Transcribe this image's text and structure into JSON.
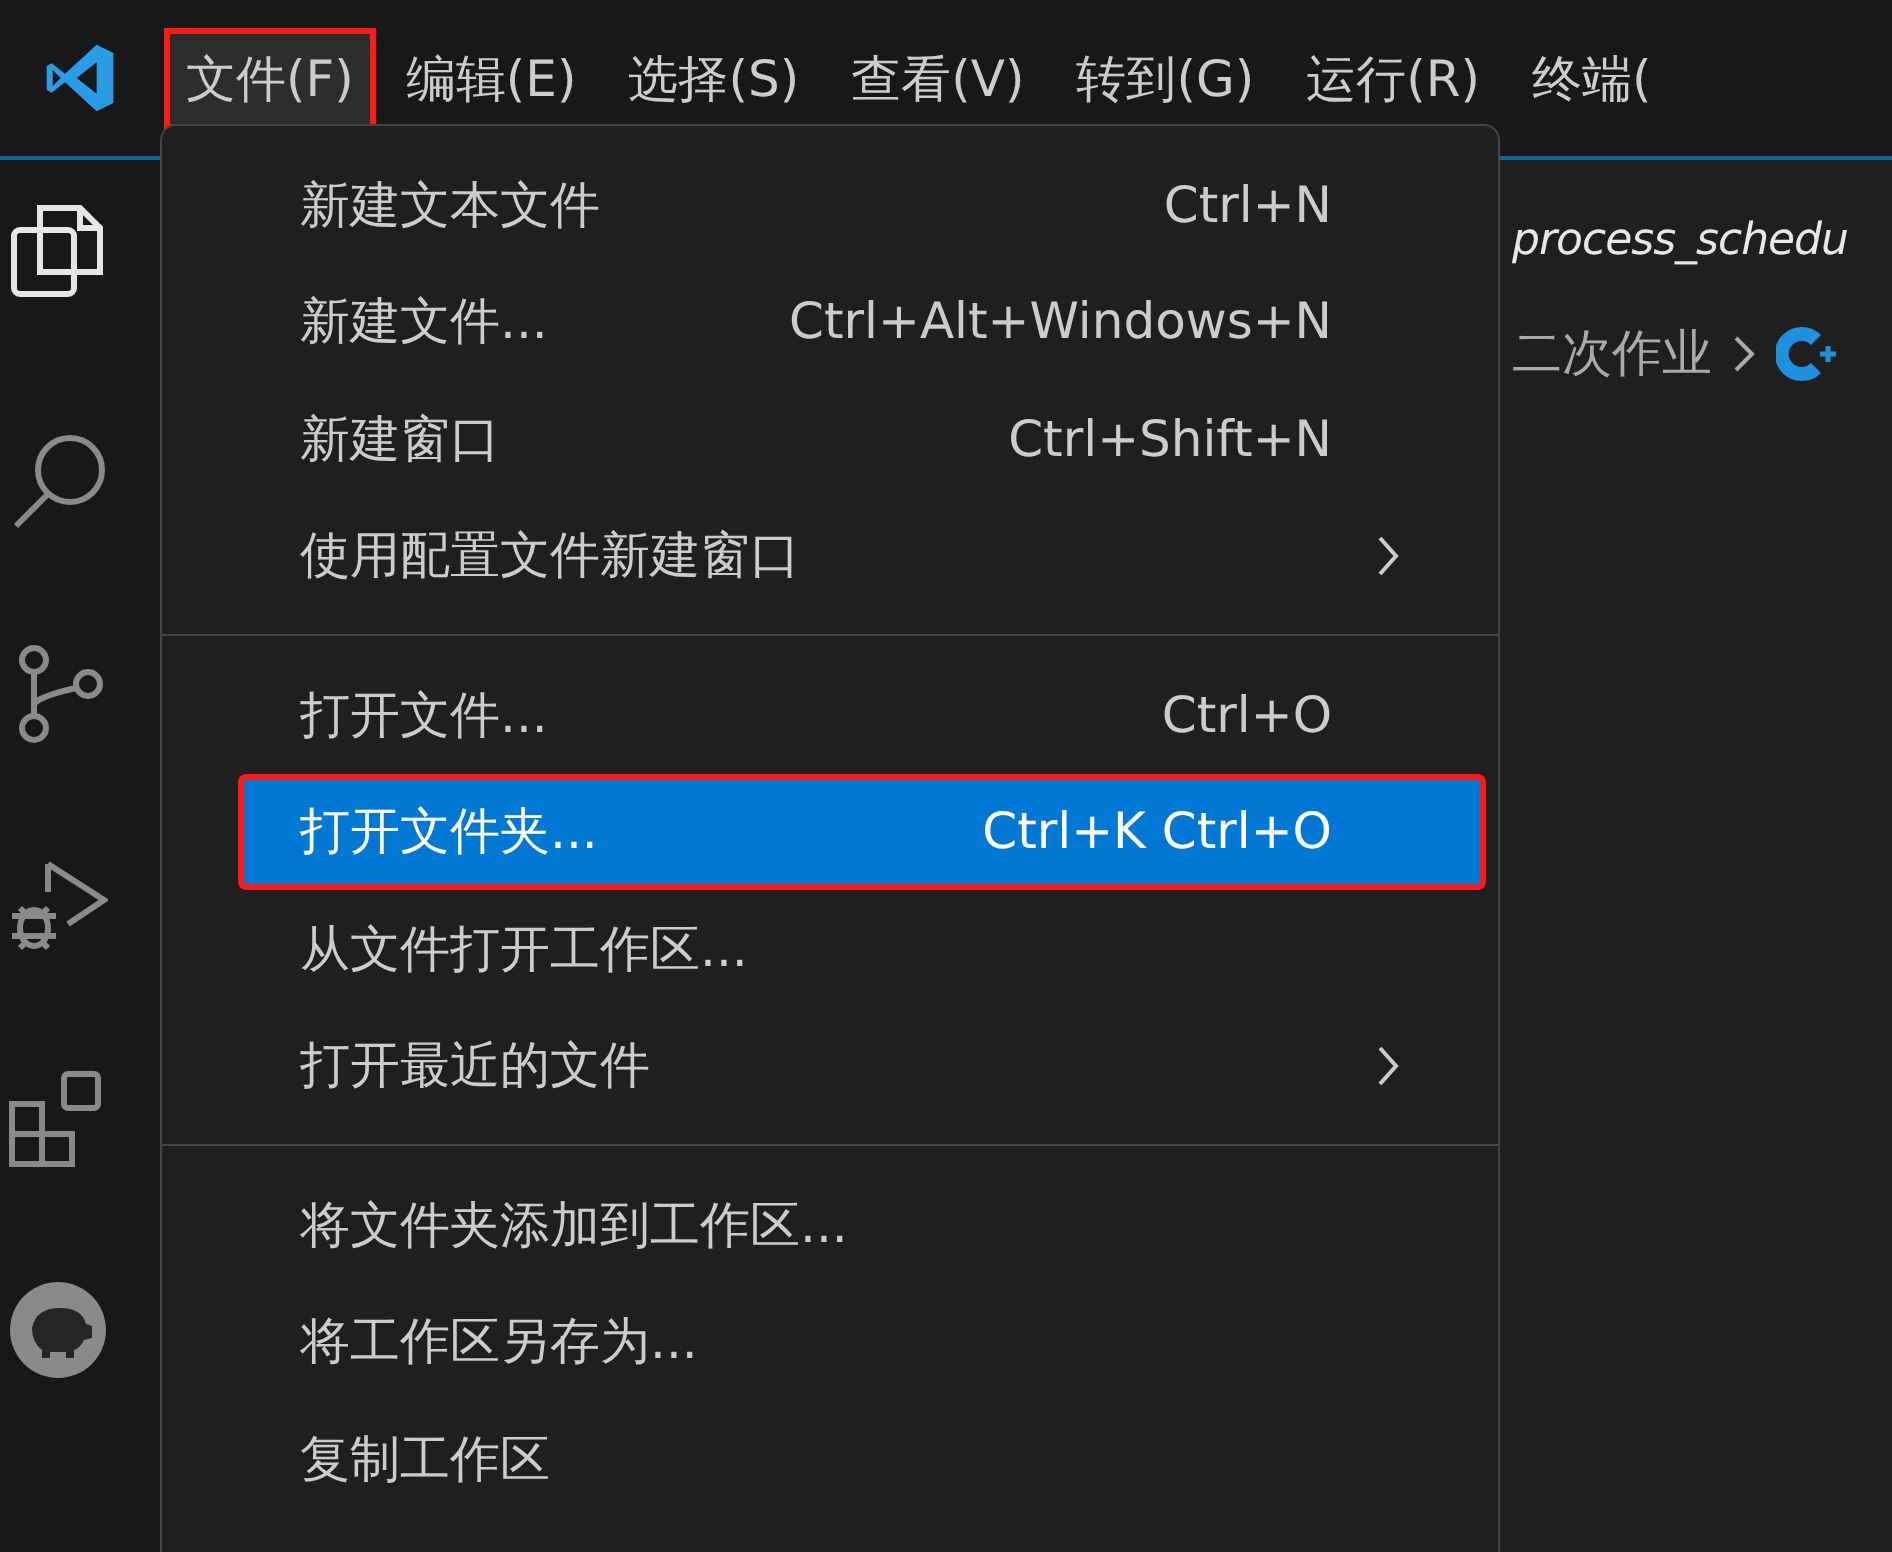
{
  "menubar": {
    "items": [
      {
        "label": "文件(F)",
        "selected": true,
        "annotated": true
      },
      {
        "label": "编辑(E)",
        "selected": false,
        "annotated": false
      },
      {
        "label": "选择(S)",
        "selected": false,
        "annotated": false
      },
      {
        "label": "查看(V)",
        "selected": false,
        "annotated": false
      },
      {
        "label": "转到(G)",
        "selected": false,
        "annotated": false
      },
      {
        "label": "运行(R)",
        "selected": false,
        "annotated": false
      },
      {
        "label": "终端(",
        "selected": false,
        "annotated": false
      }
    ]
  },
  "activity_bar": {
    "items": [
      {
        "kind": "explorer",
        "selected": true
      },
      {
        "kind": "search",
        "selected": false
      },
      {
        "kind": "source-control",
        "selected": false
      },
      {
        "kind": "run-debug",
        "selected": false
      },
      {
        "kind": "extensions",
        "selected": false
      },
      {
        "kind": "piggy",
        "selected": false
      }
    ]
  },
  "editor": {
    "tab_title": "process_schedu",
    "breadcrumb": [
      "二次作业"
    ]
  },
  "menu": {
    "groups": [
      [
        {
          "label": "新建文本文件",
          "shortcut": "Ctrl+N",
          "submenu": false,
          "selected": false,
          "annotated": false
        },
        {
          "label": "新建文件...",
          "shortcut": "Ctrl+Alt+Windows+N",
          "submenu": false,
          "selected": false,
          "annotated": false
        },
        {
          "label": "新建窗口",
          "shortcut": "Ctrl+Shift+N",
          "submenu": false,
          "selected": false,
          "annotated": false
        },
        {
          "label": "使用配置文件新建窗口",
          "submenu": true,
          "selected": false,
          "annotated": false
        }
      ],
      [
        {
          "label": "打开文件...",
          "shortcut": "Ctrl+O",
          "submenu": false,
          "selected": false,
          "annotated": false
        },
        {
          "label": "打开文件夹...",
          "shortcut": "Ctrl+K Ctrl+O",
          "submenu": false,
          "selected": true,
          "annotated": true
        },
        {
          "label": "从文件打开工作区...",
          "submenu": false,
          "selected": false,
          "annotated": false
        },
        {
          "label": "打开最近的文件",
          "submenu": true,
          "selected": false,
          "annotated": false
        }
      ],
      [
        {
          "label": "将文件夹添加到工作区...",
          "submenu": false,
          "selected": false,
          "annotated": false
        },
        {
          "label": "将工作区另存为...",
          "submenu": false,
          "selected": false,
          "annotated": false
        },
        {
          "label": "复制工作区",
          "submenu": false,
          "selected": false,
          "annotated": false
        }
      ]
    ]
  }
}
